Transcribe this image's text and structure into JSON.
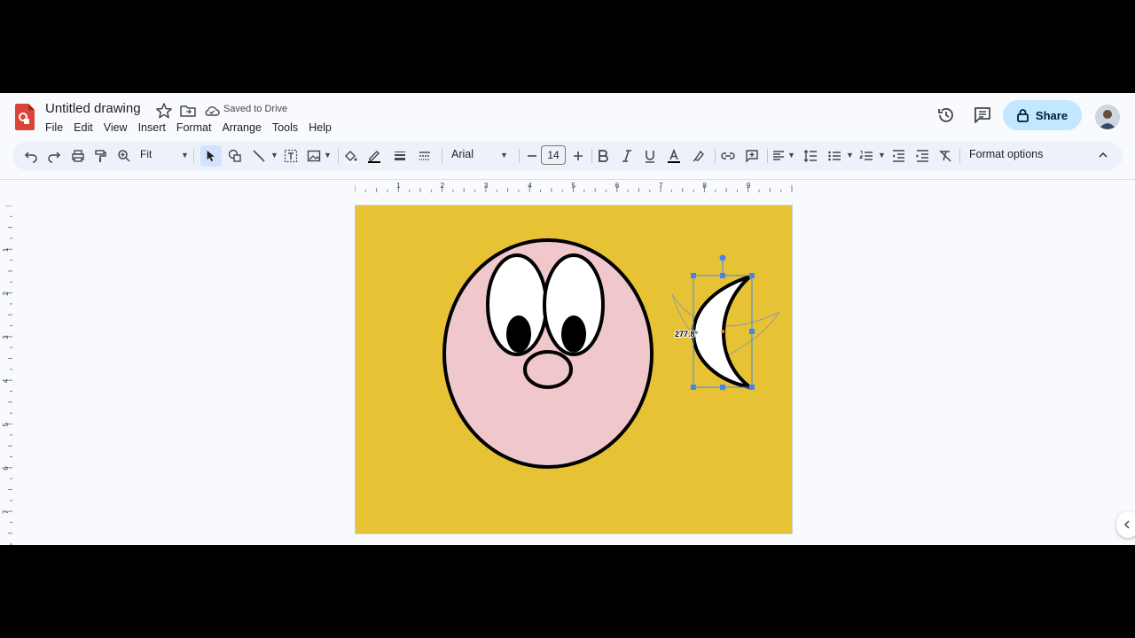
{
  "header": {
    "title": "Untitled drawing",
    "saved_status": "Saved to Drive",
    "share_label": "Share"
  },
  "menu": [
    "File",
    "Edit",
    "View",
    "Insert",
    "Format",
    "Arrange",
    "Tools",
    "Help"
  ],
  "toolbar": {
    "zoom": "Fit",
    "font": "Arial",
    "font_size": "14",
    "format_options": "Format options"
  },
  "rulers": {
    "horizontal": [
      "1",
      "2",
      "3",
      "4",
      "5",
      "6",
      "7",
      "8",
      "9"
    ],
    "vertical": [
      "1",
      "2",
      "3",
      "4",
      "5",
      "6",
      "7"
    ]
  },
  "canvas": {
    "background_color": "#e8c235",
    "face_color": "#f0c8cc",
    "rotation_readout": "277.8°"
  },
  "colors": {
    "accent": "#c2e7ff",
    "selection": "#4285f4"
  }
}
